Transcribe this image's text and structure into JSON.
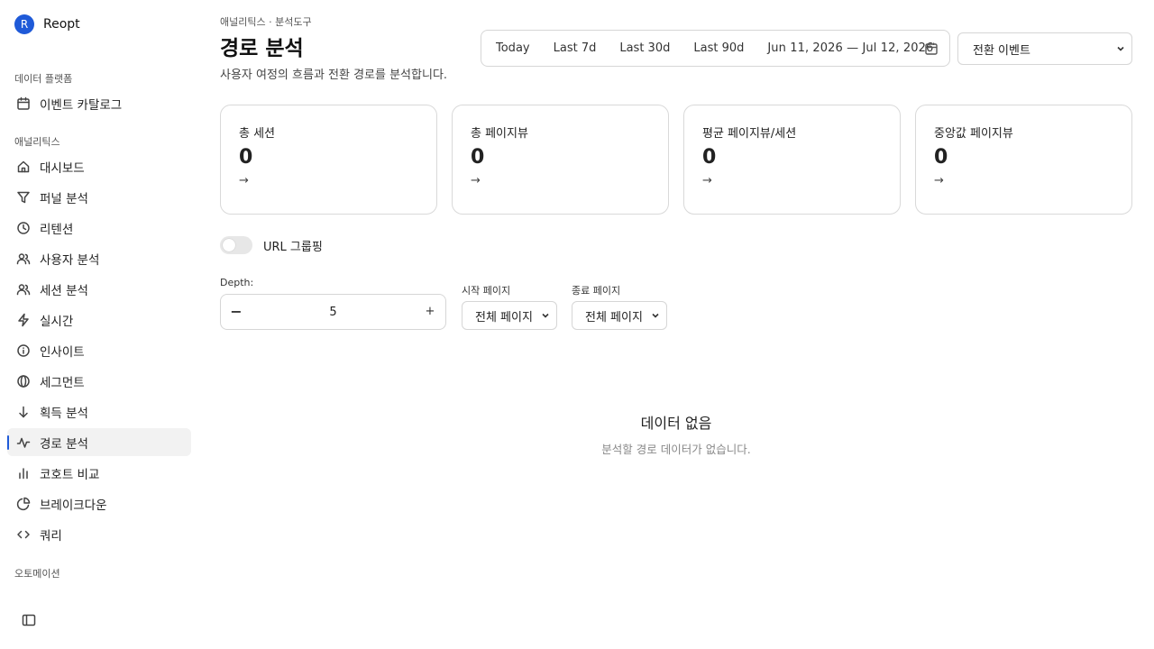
{
  "brand": {
    "initial": "R",
    "name": "Reopt",
    "color": "#1f5ad8"
  },
  "sidebar": {
    "sections": [
      {
        "label": "데이터 플랫폼"
      },
      {
        "label": "애널리틱스"
      },
      {
        "label": "오토메이션"
      }
    ],
    "items": [
      {
        "label": "이벤트 카탈로그",
        "icon": "calendar-icon"
      },
      {
        "label": "대시보드",
        "icon": "home-icon"
      },
      {
        "label": "퍼널 분석",
        "icon": "filter-icon"
      },
      {
        "label": "리텐션",
        "icon": "clock-icon"
      },
      {
        "label": "사용자 분석",
        "icon": "users-icon"
      },
      {
        "label": "세션 분석",
        "icon": "users-icon"
      },
      {
        "label": "실시간",
        "icon": "lightning-icon"
      },
      {
        "label": "인사이트",
        "icon": "info-icon"
      },
      {
        "label": "세그먼트",
        "icon": "segment-icon"
      },
      {
        "label": "획득 분석",
        "icon": "arrow-down-icon"
      },
      {
        "label": "경로 분석",
        "icon": "activity-icon",
        "active": true
      },
      {
        "label": "코호트 비교",
        "icon": "bar-chart-icon"
      },
      {
        "label": "브레이크다운",
        "icon": "pie-chart-icon"
      },
      {
        "label": "쿼리",
        "icon": "code-icon"
      }
    ]
  },
  "header": {
    "breadcrumb": "애널리틱스 · 분석도구",
    "title": "경로 분석",
    "subtitle": "사용자 여정의 흐름과 전환 경로를 분석합니다."
  },
  "date_range": {
    "presets": [
      "Today",
      "Last 7d",
      "Last 30d",
      "Last 90d"
    ],
    "range_text": "Jun 11, 2026 — Jul 12, 2026"
  },
  "event_select": {
    "value": "전환 이벤트"
  },
  "metrics": [
    {
      "label": "총 세션",
      "value": "0",
      "arrow": "→"
    },
    {
      "label": "총 페이지뷰",
      "value": "0",
      "arrow": "→"
    },
    {
      "label": "평균 페이지뷰/세션",
      "value": "0",
      "arrow": "→"
    },
    {
      "label": "중앙값 페이지뷰",
      "value": "0",
      "arrow": "→"
    }
  ],
  "url_grouping": {
    "label": "URL 그룹핑",
    "enabled": false
  },
  "depth": {
    "label": "Depth:",
    "value": "5",
    "minus": "−",
    "plus": "+"
  },
  "start_page": {
    "label": "시작 페이지",
    "value": "전체 페이지"
  },
  "end_page": {
    "label": "종료 페이지",
    "value": "전체 페이지"
  },
  "empty_state": {
    "title": "데이터 없음",
    "subtitle": "분석할 경로 데이터가 없습니다."
  }
}
